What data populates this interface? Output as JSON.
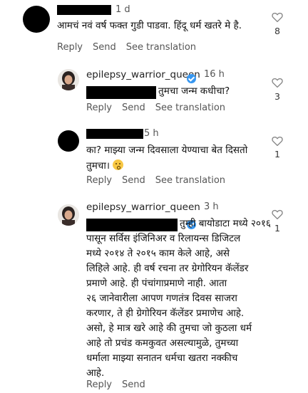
{
  "icons": {
    "like": "heart-outline-icon",
    "verified": "verified-badge-icon",
    "emoji": "astonished-face-emoji"
  },
  "comments": [
    {
      "time": "1 d",
      "text": "आमचं नवं वर्ष फक्त गुडी पाडवा. हिंदू धर्म खतरे मे है.",
      "likes": "8",
      "actions": {
        "reply": "Reply",
        "send": "Send",
        "translate": "See translation"
      }
    },
    {
      "username": "epilepsy_warrior_queen",
      "time": "16 h",
      "text": "तुमचा जन्म कधीचा?",
      "likes": "3",
      "actions": {
        "reply": "Reply",
        "send": "Send",
        "translate": "See translation"
      }
    },
    {
      "time": "5 h",
      "text_line1": "का? माझ्या जन्म दिवसाला येण्याचा बेत दिसतो",
      "text_line2": "तुमचा। ",
      "likes": "1",
      "actions": {
        "reply": "Reply",
        "send": "Send",
        "translate": "See translation"
      }
    },
    {
      "username": "epilepsy_warrior_queen",
      "time": "3 h",
      "lines": [
        "तुम्ही बायोडाटा मध्ये २०१६",
        "पासून सर्विस इंजिनिअर व रिलायन्स डिजिटल",
        "मध्ये २०१४ ते २०१५ काम केले आहे, असे",
        "लिहिले आहे. ही वर्ष रचना तर ग्रेगोरियन कॅलेंडर",
        "प्रमाणे आहे. ही पंचांगाप्रमाणे नाही. आता",
        "२६ जानेवारीला आपण गणतंत्र दिवस साजरा",
        "करणार, ते ही ग्रेगोरियन कॅलेंडर प्रमाणेच आहे.",
        "असो, हे मात्र खरे आहे की तुमचा जो कुठला धर्म",
        "आहे तो प्रचंड कमकुवत असल्यामुळे, तुमच्या",
        "धर्माला माझ्या सनातन धर्मचा खतरा नक्कीच",
        "आहे."
      ],
      "likes": "1",
      "actions": {
        "reply": "Reply",
        "send": "Send"
      }
    }
  ]
}
